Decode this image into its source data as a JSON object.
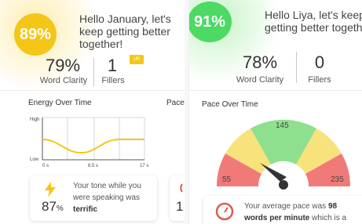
{
  "left": {
    "score": "89%",
    "greeting": [
      "Hello January, let's",
      "keep getting better",
      "together!"
    ],
    "word_clarity_value": "79%",
    "word_clarity_label": "Word Clarity",
    "fillers_value": "1",
    "fillers_label": "Fillers",
    "badge_label": "uh",
    "energy_title": "Energy Over Time",
    "energy_y_high": "High",
    "energy_y_low": "Low",
    "energy_x_ticks": [
      "0 s",
      "8.5 s",
      "17 s"
    ],
    "pace_title_partial": "Pace",
    "tone_text_before": "Your tone while you were speaking was",
    "tone_text_bold": "terrific",
    "tone_percent": "87",
    "tone_percent_sign": "%",
    "peek_digit": "1"
  },
  "right": {
    "score": "91%",
    "greeting": [
      "Hello Liya, let's keep",
      "getting better together"
    ],
    "word_clarity_value": "78%",
    "word_clarity_label": "Word Clarity",
    "fillers_value": "0",
    "fillers_label": "Fillers",
    "pace_title": "Pace Over Time",
    "gauge_low": "55",
    "gauge_mid": "145",
    "gauge_high": "235",
    "pace_text_1": "Your average pace was",
    "pace_value": "98",
    "pace_text_2": "words per minute",
    "pace_text_3": "which is a"
  },
  "colors": {
    "yellow": "#f5c518",
    "green": "#4cd964",
    "gauge_red": "#f07a78",
    "gauge_yellow": "#f8e27c",
    "gauge_green": "#8ee08e"
  },
  "icons": [
    "lightning-icon",
    "speedometer-icon"
  ]
}
